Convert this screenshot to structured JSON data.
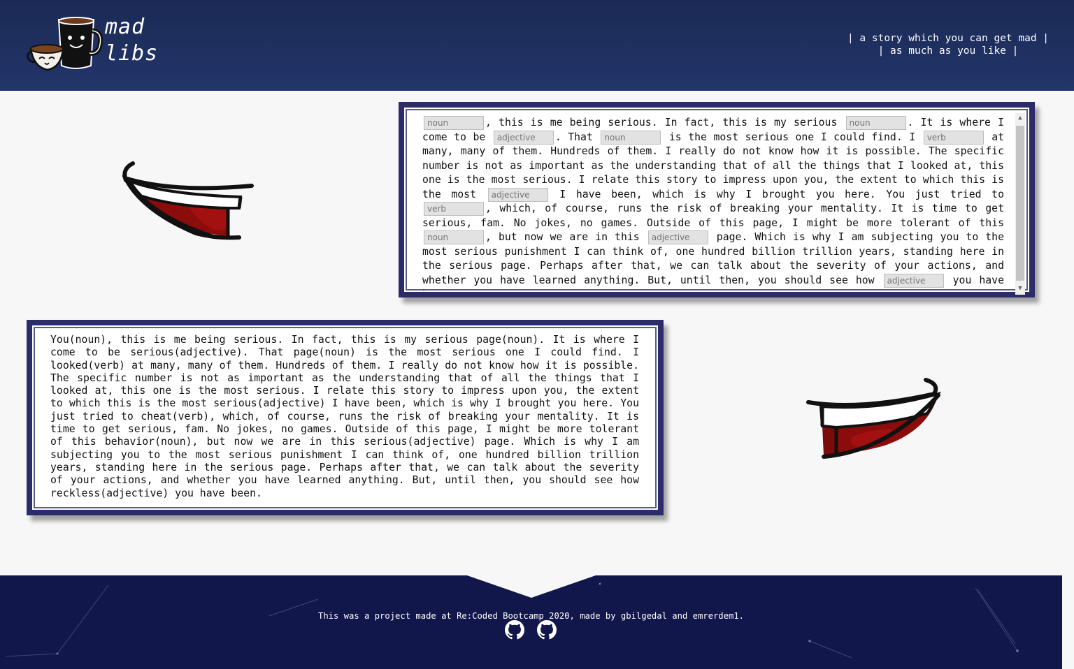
{
  "header": {
    "logo_line1": "mad",
    "logo_line2": "libs",
    "tagline_line1": "| a story which you can get mad |",
    "tagline_line2": "| as much as you like |"
  },
  "form": {
    "segments": [
      {
        "type": "input",
        "placeholder": "noun"
      },
      {
        "type": "text",
        "value": ", this is me being serious. In fact, this is my serious "
      },
      {
        "type": "input",
        "placeholder": "noun"
      },
      {
        "type": "text",
        "value": ". It is where I come to be "
      },
      {
        "type": "input",
        "placeholder": "adjective"
      },
      {
        "type": "text",
        "value": ". That "
      },
      {
        "type": "input",
        "placeholder": "noun"
      },
      {
        "type": "text",
        "value": " is the most serious one I could find. I "
      },
      {
        "type": "input",
        "placeholder": "verb"
      },
      {
        "type": "text",
        "value": " at many, many of them. Hundreds of them. I really do not know how it is possible. The specific number is not as important as the understanding that of all the things that I looked at, this one is the most serious. I relate this story to impress upon you, the extent to which this is the most "
      },
      {
        "type": "input",
        "placeholder": "adjective"
      },
      {
        "type": "text",
        "value": " I have been, which is why I brought you here. You just tried to "
      },
      {
        "type": "input",
        "placeholder": "verb"
      },
      {
        "type": "text",
        "value": ", which, of course, runs the risk of breaking your mentality. It is time to get serious, fam. No jokes, no games. Outside of this page, I might be more tolerant of this "
      },
      {
        "type": "input",
        "placeholder": "noun"
      },
      {
        "type": "text",
        "value": ", but now we are in this "
      },
      {
        "type": "input",
        "placeholder": "adjective"
      },
      {
        "type": "text",
        "value": " page. Which is why I am subjecting you to the most serious punishment I can think of, one hundred billion trillion years, standing here in the serious page. Perhaps after that, we can talk about the severity of your actions, and whether you have learned anything. But, until then, you should see how "
      },
      {
        "type": "input",
        "placeholder": "adjective"
      },
      {
        "type": "text",
        "value": " you have been."
      }
    ]
  },
  "result": {
    "text": "You(noun), this is me being serious. In fact, this is my serious page(noun). It is where I come to be serious(adjective). That page(noun) is the most serious one I could find. I looked(verb) at many, many of them. Hundreds of them. I really do not know how it is possible. The specific number is not as important as the understanding that of all the things that I looked at, this one is the most serious. I relate this story to impress upon you, the extent to which this is the most serious(adjective) I have been, which is why I brought you here. You just tried to cheat(verb), which, of course, runs the risk of breaking your mentality. It is time to get serious, fam. No jokes, no games. Outside of this page, I might be more tolerant of this behavior(noun), but now we are in this serious(adjective) page. Which is why I am subjecting you to the most serious punishment I can think of, one hundred billion trillion years, standing here in the serious page. Perhaps after that, we can talk about the severity of your actions, and whether you have learned anything. But, until then, you should see how reckless(adjective) you have been."
  },
  "footer": {
    "credit": "This was a project made at Re:Coded Bootcamp 2020, made by gbilgedal and emrerdem1.",
    "icons": [
      "github-icon",
      "github-icon"
    ]
  },
  "colors": {
    "header_bg": "#1b2a55",
    "frame_border": "#2c2c6a",
    "footer_bg": "#11174a",
    "mouth_red": "#8b0a0a"
  }
}
